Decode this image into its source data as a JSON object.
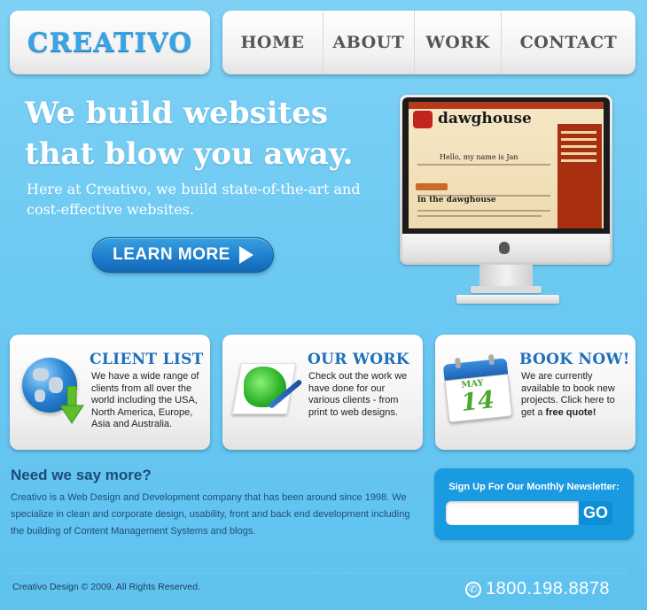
{
  "header": {
    "logo": "CREATIVO",
    "nav": [
      "HOME",
      "ABOUT",
      "WORK",
      "CONTACT"
    ]
  },
  "hero": {
    "headline": "We build websites that blow you away.",
    "subheadline": "Here at Creativo, we build state-of-the-art and cost-effective websites.",
    "cta_label": "LEARN MORE"
  },
  "screen_preview": {
    "site_title": "dawghouse",
    "hello": "Hello, my name is Jan",
    "section": "in the dawghouse"
  },
  "cards": [
    {
      "title": "CLIENT LIST",
      "text": "We have a wide range of clients from all over the world including the USA, North America, Europe, Asia and Australia.",
      "icon": "globe-download-icon"
    },
    {
      "title": "OUR WORK",
      "text": "Check out the work we have done for our various clients - from print to web designs.",
      "icon": "paint-brush-icon"
    },
    {
      "title": "BOOK NOW!",
      "text": "We are currently available to book new projects. Click here to get a",
      "text_bold": "free quote!",
      "icon": "calendar-icon",
      "calendar_month": "MAY",
      "calendar_day": "14"
    }
  ],
  "about": {
    "title": "Need we say more?",
    "text": "Creativo is a Web Design and Development company that has been around since 1998. We specialize in clean and corporate design, usability, front and back end development including the building of Content Management Systems and blogs."
  },
  "newsletter": {
    "title": "Sign Up For Our Monthly Newsletter:",
    "input_value": "",
    "button_label": "GO"
  },
  "footer": {
    "copyright": "Creativo Design © 2009. All Rights Reserved.",
    "phone": "1800.198.8878"
  },
  "colors": {
    "background": "#6cc9f2",
    "accent_blue": "#1f6fba",
    "newsletter_bg": "#1a9ae0"
  }
}
